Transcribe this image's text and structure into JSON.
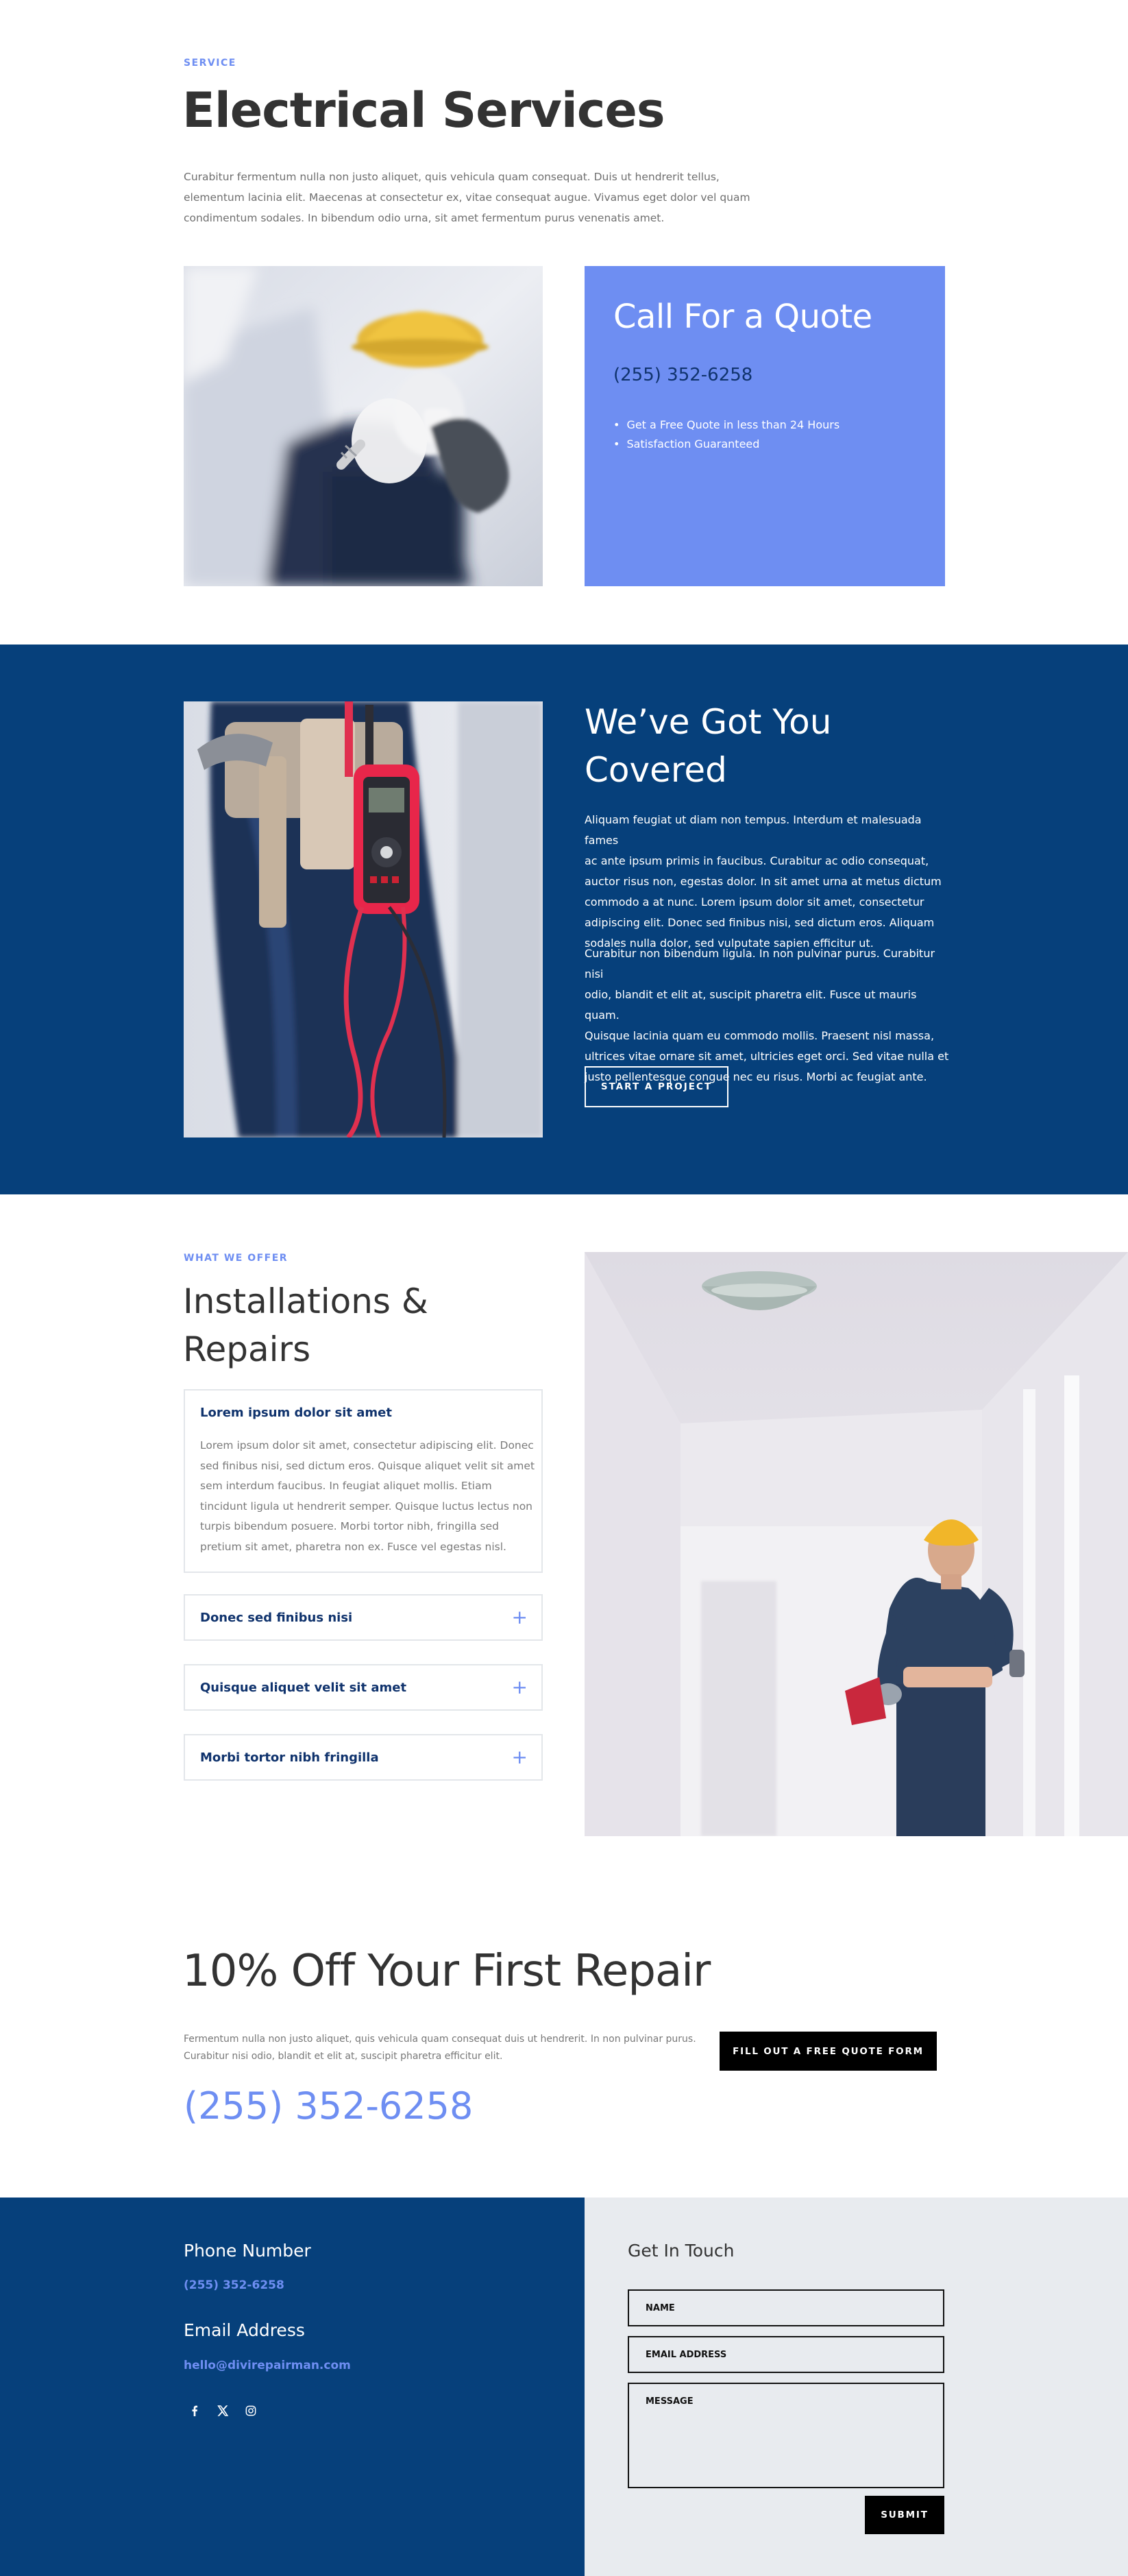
{
  "hero": {
    "eyebrow": "SERVICE",
    "title": "Electrical Services",
    "paragraph_lines": [
      "Curabitur fermentum nulla non justo aliquet, quis vehicula quam consequat. Duis ut hendrerit tellus,",
      "elementum lacinia elit. Maecenas at consectetur ex, vitae consequat augue. Vivamus eget dolor vel quam",
      "condimentum sodales. In bibendum odio urna, sit amet fermentum purus venenatis amet."
    ]
  },
  "quote_box": {
    "title": "Call For a Quote",
    "phone": "(255) 352-6258",
    "bullets": [
      "Get a Free Quote in less than 24 Hours",
      "Satisfaction Guaranteed"
    ]
  },
  "covered": {
    "title_line1": "We’ve Got You",
    "title_line2": "Covered",
    "para1_lines": [
      "Aliquam feugiat ut diam non tempus. Interdum et malesuada fames",
      "ac ante ipsum primis in faucibus. Curabitur ac odio consequat,",
      "auctor risus non, egestas dolor. In sit amet urna at metus dictum",
      "commodo a at nunc. Lorem ipsum dolor sit amet, consectetur",
      "adipiscing elit. Donec sed finibus nisi, sed dictum eros. Aliquam",
      "sodales nulla dolor, sed vulputate sapien efficitur ut."
    ],
    "para2_lines": [
      "Curabitur non bibendum ligula. In non pulvinar purus. Curabitur nisi",
      "odio, blandit et elit at, suscipit pharetra elit. Fusce ut mauris quam.",
      "Quisque lacinia quam eu commodo mollis. Praesent nisl massa,",
      "ultrices vitae ornare sit amet, ultricies eget orci. Sed vitae nulla et",
      "justo pellentesque congue nec eu risus. Morbi ac feugiat ante."
    ],
    "button": "START A PROJECT"
  },
  "offer": {
    "eyebrow": "WHAT WE OFFER",
    "title_line1": "Installations &",
    "title_line2": "Repairs",
    "accordion": [
      {
        "title": "Lorem ipsum dolor sit amet",
        "body_lines": [
          "Lorem ipsum dolor sit amet, consectetur adipiscing elit. Donec",
          "sed finibus nisi, sed dictum eros. Quisque aliquet velit sit amet",
          "sem interdum faucibus. In feugiat aliquet mollis. Etiam",
          "tincidunt ligula ut hendrerit semper. Quisque luctus lectus non",
          "turpis bibendum posuere. Morbi tortor nibh, fringilla sed",
          "pretium sit amet, pharetra non ex. Fusce vel egestas nisl."
        ]
      },
      {
        "title": "Donec sed finibus nisi",
        "toggle": "+"
      },
      {
        "title": "Quisque aliquet velit sit amet",
        "toggle": "+"
      },
      {
        "title": "Morbi tortor nibh fringilla",
        "toggle": "+"
      }
    ]
  },
  "promo": {
    "title": "10% Off Your First Repair",
    "text_lines": [
      "Fermentum nulla non justo aliquet, quis vehicula quam consequat duis ut hendrerit. In non pulvinar purus.",
      "Curabitur nisi odio, blandit et elit at, suscipit pharetra efficitur elit."
    ],
    "phone": "(255) 352-6258",
    "button": "FILL OUT A FREE QUOTE FORM"
  },
  "footer": {
    "phone_heading": "Phone Number",
    "phone": "(255) 352-6258",
    "email_heading": "Email Address",
    "email": "hello@divirepairman.com",
    "social_icons": [
      "facebook-icon",
      "x-icon",
      "instagram-icon"
    ],
    "form": {
      "heading": "Get In Touch",
      "name_placeholder": "NAME",
      "email_placeholder": "EMAIL ADDRESS",
      "message_placeholder": "MESSAGE",
      "submit": "SUBMIT"
    }
  },
  "colors": {
    "accent": "#6e8ef2",
    "navy": "#06407b",
    "dark_text": "#333333",
    "footer_light": "#e8ebef"
  }
}
